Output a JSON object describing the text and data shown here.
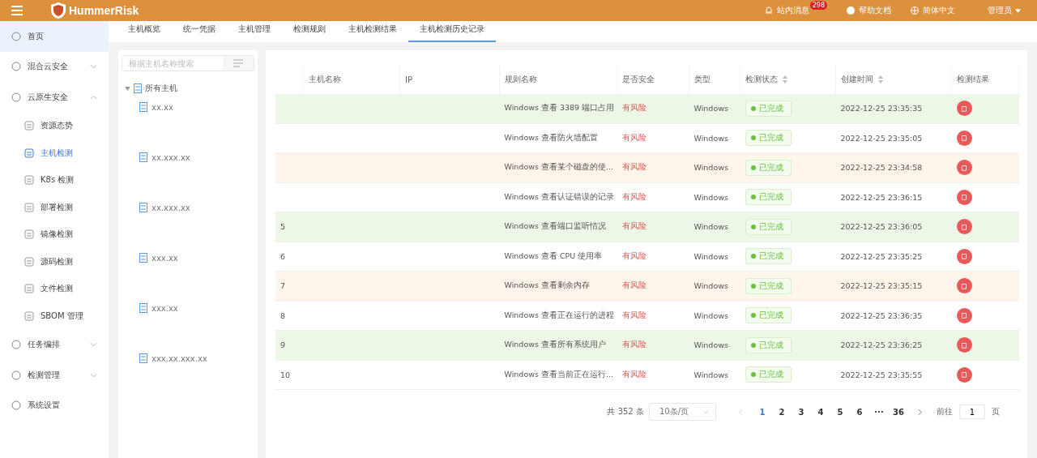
{
  "header": {
    "logo": "HummerRisk",
    "messages": "站内消息",
    "badge": "298",
    "help": "帮助文档",
    "language": "简体中文",
    "user": "管理员"
  },
  "sidebar": [
    {
      "label": "首页",
      "selected": true
    },
    {
      "label": "混合云安全",
      "selected": false,
      "expanded": false
    },
    {
      "label": "云原生安全",
      "selected": false,
      "expanded": true,
      "children": [
        {
          "label": "资源态势",
          "selected": false
        },
        {
          "label": "主机检测",
          "selected": true
        },
        {
          "label": "K8s 检测",
          "selected": false
        },
        {
          "label": "部署检测",
          "selected": false
        },
        {
          "label": "镜像检测",
          "selected": false
        },
        {
          "label": "源码检测",
          "selected": false
        },
        {
          "label": "文件检测",
          "selected": false
        },
        {
          "label": "SBOM 管理",
          "selected": false
        }
      ]
    },
    {
      "label": "任务编排",
      "selected": false,
      "expanded": false
    },
    {
      "label": "检测管理",
      "selected": false,
      "expanded": false
    },
    {
      "label": "系统设置",
      "selected": false
    }
  ],
  "tabs": [
    {
      "label": "主机概览",
      "selected": false
    },
    {
      "label": "统一凭据",
      "selected": false
    },
    {
      "label": "主机管理",
      "selected": false
    },
    {
      "label": "检测规则",
      "selected": false
    },
    {
      "label": "主机检测结果",
      "selected": false
    },
    {
      "label": "主机检测历史记录",
      "selected": true
    }
  ],
  "tree": {
    "search_placeholder": "根据主机名称搜索",
    "root": {
      "label": "所有主机",
      "expanded": true,
      "children": [
        {
          "label": "xx.xx"
        },
        {
          "label": "xx.xxx.xx"
        },
        {
          "label": "xx.xxx.xx"
        },
        {
          "label": "xxx.xx"
        },
        {
          "label": "xxx.xx"
        },
        {
          "label": "xxx.xx.xxx.xx"
        }
      ]
    }
  },
  "table": {
    "columns": [
      {
        "label": "主机名称",
        "sortable": false
      },
      {
        "label": "IP",
        "sortable": false
      },
      {
        "label": "规则名称",
        "sortable": false
      },
      {
        "label": "是否安全",
        "sortable": false
      },
      {
        "label": "类型",
        "sortable": false
      },
      {
        "label": "检测状态",
        "sortable": true
      },
      {
        "label": "创建时间",
        "sortable": true
      },
      {
        "label": "检测结果",
        "sortable": false
      }
    ],
    "rows": [
      {
        "color": "#edf7e8",
        "rule": "Windows 查看 3389 端口占用",
        "safe": "有风险",
        "type": "Windows",
        "status": "已完成",
        "time": "2022-12-25 23:35:35"
      },
      {
        "color": "#ffffff",
        "rule": "Windows 查看防火墙配置",
        "safe": "有风险",
        "type": "Windows",
        "status": "已完成",
        "time": "2022-12-25 23:35:05"
      },
      {
        "color": "#fdf5ea",
        "rule": "Windows 查看某个磁盘的使...",
        "safe": "有风险",
        "type": "Windows",
        "status": "已完成",
        "time": "2022-12-25 23:34:58"
      },
      {
        "color": "#ffffff",
        "rule": "Windows 查看认证错误的记录",
        "safe": "有风险",
        "type": "Windows",
        "status": "已完成",
        "time": "2022-12-25 23:36:15"
      },
      {
        "color": "#edf7e8",
        "index": "5",
        "rule": "Windows 查看端口监听情况",
        "safe": "有风险",
        "type": "Windows",
        "status": "已完成",
        "time": "2022-12-25 23:36:05"
      },
      {
        "color": "#ffffff",
        "index": "6",
        "rule": "Windows 查看 CPU 使用率",
        "safe": "有风险",
        "type": "Windows",
        "status": "已完成",
        "time": "2022-12-25 23:35:25"
      },
      {
        "color": "#fdf5ea",
        "index": "7",
        "rule": "Windows 查看剩余内存",
        "safe": "有风险",
        "type": "Windows",
        "status": "已完成",
        "time": "2022-12-25 23:35:15"
      },
      {
        "color": "#ffffff",
        "index": "8",
        "rule": "Windows 查看正在运行的进程",
        "safe": "有风险",
        "type": "Windows",
        "status": "已完成",
        "time": "2022-12-25 23:36:35"
      },
      {
        "color": "#edf7e8",
        "index": "9",
        "rule": "Windows 查看所有系统用户",
        "safe": "有风险",
        "type": "Windows",
        "status": "已完成",
        "time": "2022-12-25 23:36:25"
      },
      {
        "color": "#ffffff",
        "index": "10",
        "rule": "Windows 查看当前正在运行...",
        "safe": "有风险",
        "type": "Windows",
        "status": "已完成",
        "time": "2022-12-25 23:35:55"
      }
    ]
  },
  "pagination": {
    "total": "共 352 条",
    "page_size": "10条/页",
    "pages": [
      {
        "label": "1",
        "selected": true
      },
      {
        "label": "2",
        "selected": false
      },
      {
        "label": "3",
        "selected": false
      },
      {
        "label": "4",
        "selected": false
      },
      {
        "label": "5",
        "selected": false
      },
      {
        "label": "6",
        "selected": false
      },
      {
        "label": "···",
        "selected": false
      },
      {
        "label": "36",
        "selected": false
      }
    ],
    "goto": "前往",
    "goto_value": "1",
    "goto_unit": "页"
  }
}
